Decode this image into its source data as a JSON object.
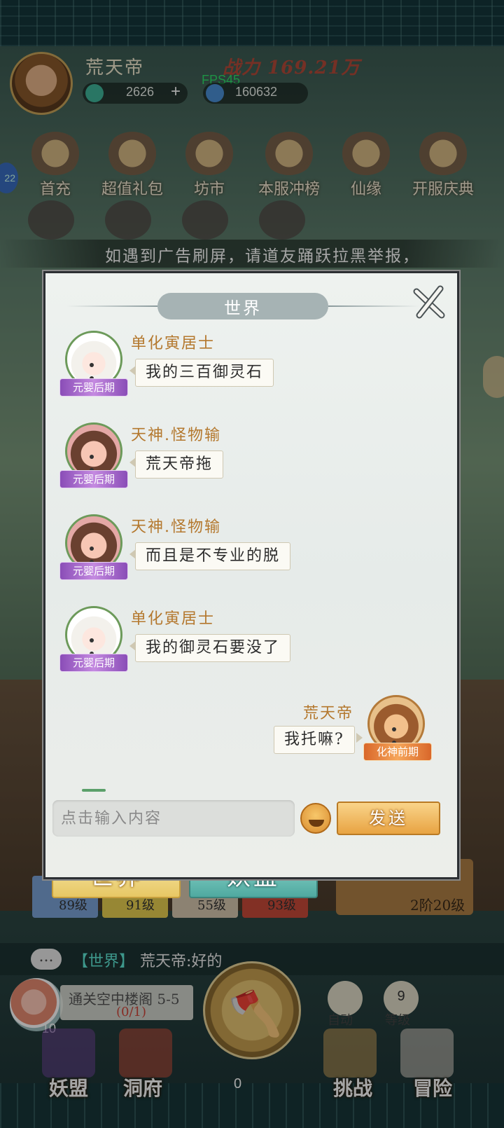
{
  "status": {
    "fps": "FPS45"
  },
  "player": {
    "name": "荒天帝",
    "power": "战力 169.21万",
    "jade": "2626",
    "jade_plus": "+",
    "spirit_stone": "160632"
  },
  "features": [
    "首充",
    "超值礼包",
    "坊市",
    "本服冲榜",
    "仙缘",
    "开服庆典"
  ],
  "side_badge": "22",
  "notice": "如遇到广告刷屏，请道友踊跃拉黑举报，",
  "modal": {
    "title": "世界",
    "messages": [
      {
        "user": "单化寅居士",
        "rank": "元婴后期",
        "text": "我的三百御灵石",
        "avatar": "girl"
      },
      {
        "user": "天神.怪物输",
        "rank": "元婴后期",
        "text": "荒天帝拖",
        "avatar": "kid"
      },
      {
        "user": "天神.怪物输",
        "rank": "元婴后期",
        "text": "而且是不专业的脱",
        "avatar": "kid"
      },
      {
        "user": "单化寅居士",
        "rank": "元婴后期",
        "text": "我的御灵石要没了",
        "avatar": "girl"
      }
    ],
    "my_message": {
      "user": "荒天帝",
      "rank": "化神前期",
      "text": "我托嘛?"
    },
    "input_placeholder": "点击输入内容",
    "send_label": "发送",
    "tabs": {
      "world": "世界",
      "yaomeng": "妖盟"
    }
  },
  "levels": [
    "89级",
    "91级",
    "55级",
    "93级",
    "2阶20级"
  ],
  "chat_strip": {
    "tag": "【世界】",
    "message": "荒天帝:好的",
    "icon": "..."
  },
  "quest": {
    "title": "通关空中楼阁 5-5",
    "progress": "(0/1)",
    "peach_count": "10"
  },
  "buttons": {
    "auto": "自动",
    "level": "等级",
    "level_value": "9"
  },
  "nav": {
    "yaomeng": "妖盟",
    "dongfu": "洞府",
    "challenge": "挑战",
    "adventure": "冒险",
    "gold": "0"
  },
  "colors": {
    "accent_gold": "#e8a342",
    "world_tab": "#e7c764",
    "yaomeng_tab": "#4fa9a0",
    "rank_purple": "#8a4db7",
    "fps_green": "#2ee06a"
  }
}
